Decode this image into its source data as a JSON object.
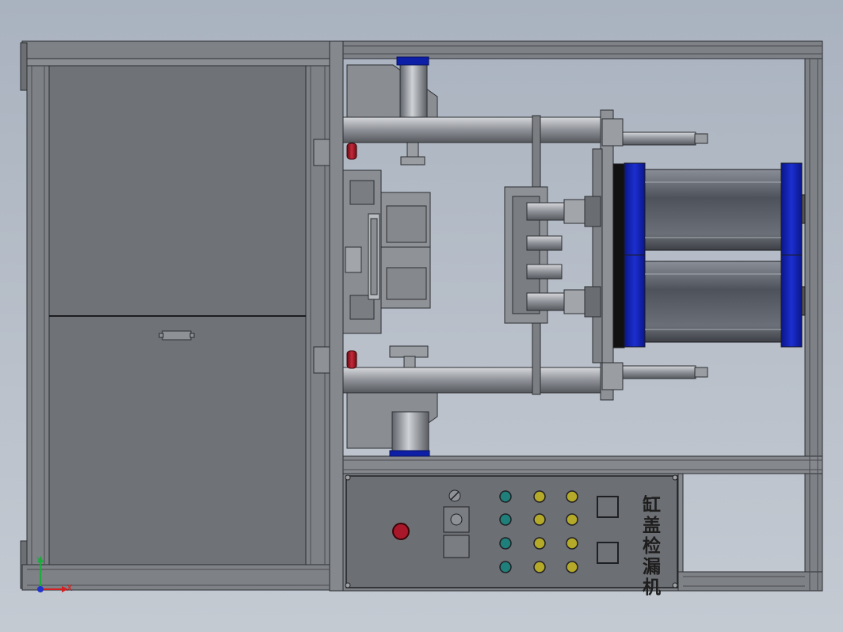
{
  "panel": {
    "label": "缸盖检漏机",
    "rows": 4,
    "lamp_columns": [
      {
        "name": "teal",
        "color": "#1f7f7a"
      },
      {
        "name": "yellow-1",
        "color": "#b5a92a"
      },
      {
        "name": "yellow-2",
        "color": "#b5a92a"
      }
    ],
    "emergency_color": "#a8182a",
    "square_buttons": 2
  },
  "axes": {
    "x": "X",
    "y": "Y",
    "x_color": "#d42020",
    "y_color": "#1faa40",
    "z_color": "#2233cc"
  },
  "colors": {
    "frame": "#7e8186",
    "cabinet": "#6f7277",
    "cylinder_caps": "#0d1fa6",
    "cylinder_body": "#5a5d64"
  }
}
